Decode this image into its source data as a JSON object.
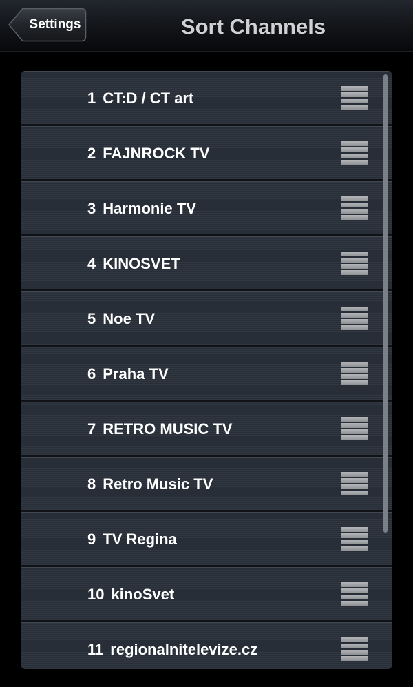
{
  "header": {
    "back_label": "Settings",
    "title": "Sort Channels"
  },
  "channels": [
    {
      "number": "1",
      "name": "CT:D / CT art"
    },
    {
      "number": "2",
      "name": "FAJNROCK TV"
    },
    {
      "number": "3",
      "name": "Harmonie TV"
    },
    {
      "number": "4",
      "name": "KINOSVET"
    },
    {
      "number": "5",
      "name": "Noe TV"
    },
    {
      "number": "6",
      "name": "Praha TV"
    },
    {
      "number": "7",
      "name": "RETRO MUSIC TV"
    },
    {
      "number": "8",
      "name": "Retro Music TV"
    },
    {
      "number": "9",
      "name": "TV Regina"
    },
    {
      "number": "10",
      "name": "kinoSvet"
    },
    {
      "number": "11",
      "name": "regionalnitelevize.cz"
    }
  ],
  "icons": {
    "back": "back-arrow-button",
    "handle": "drag-handle-icon"
  },
  "colors": {
    "background": "#000000",
    "row": "#2b313b",
    "title": "#cfd1d4",
    "handle": "#a4a6a9"
  }
}
